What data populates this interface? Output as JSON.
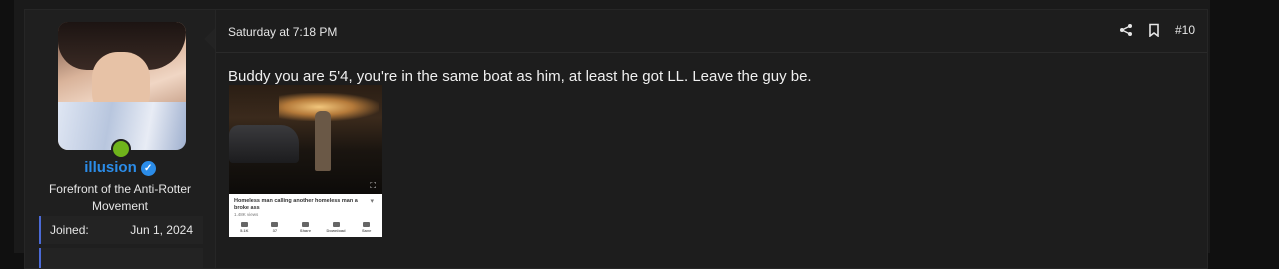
{
  "author": {
    "username": "illusion",
    "title": "Forefront of the Anti-Rotter Movement",
    "joined_label": "Joined:",
    "joined_value": "Jun 1, 2024"
  },
  "post": {
    "date": "Saturday at 7:18 PM",
    "number": "#10",
    "text": "Buddy you are 5'4, you're in the same boat as him, at least he got LL. Leave the guy be."
  },
  "embed": {
    "caption": "Homeless man calling another homeless man a broke ass",
    "views": "1.48K views",
    "actions": [
      "5.1K",
      "37",
      "Share",
      "Download",
      "Save"
    ]
  },
  "colors": {
    "username": "#2b8ce8",
    "online": "#6fb31b",
    "background": "#101010"
  }
}
